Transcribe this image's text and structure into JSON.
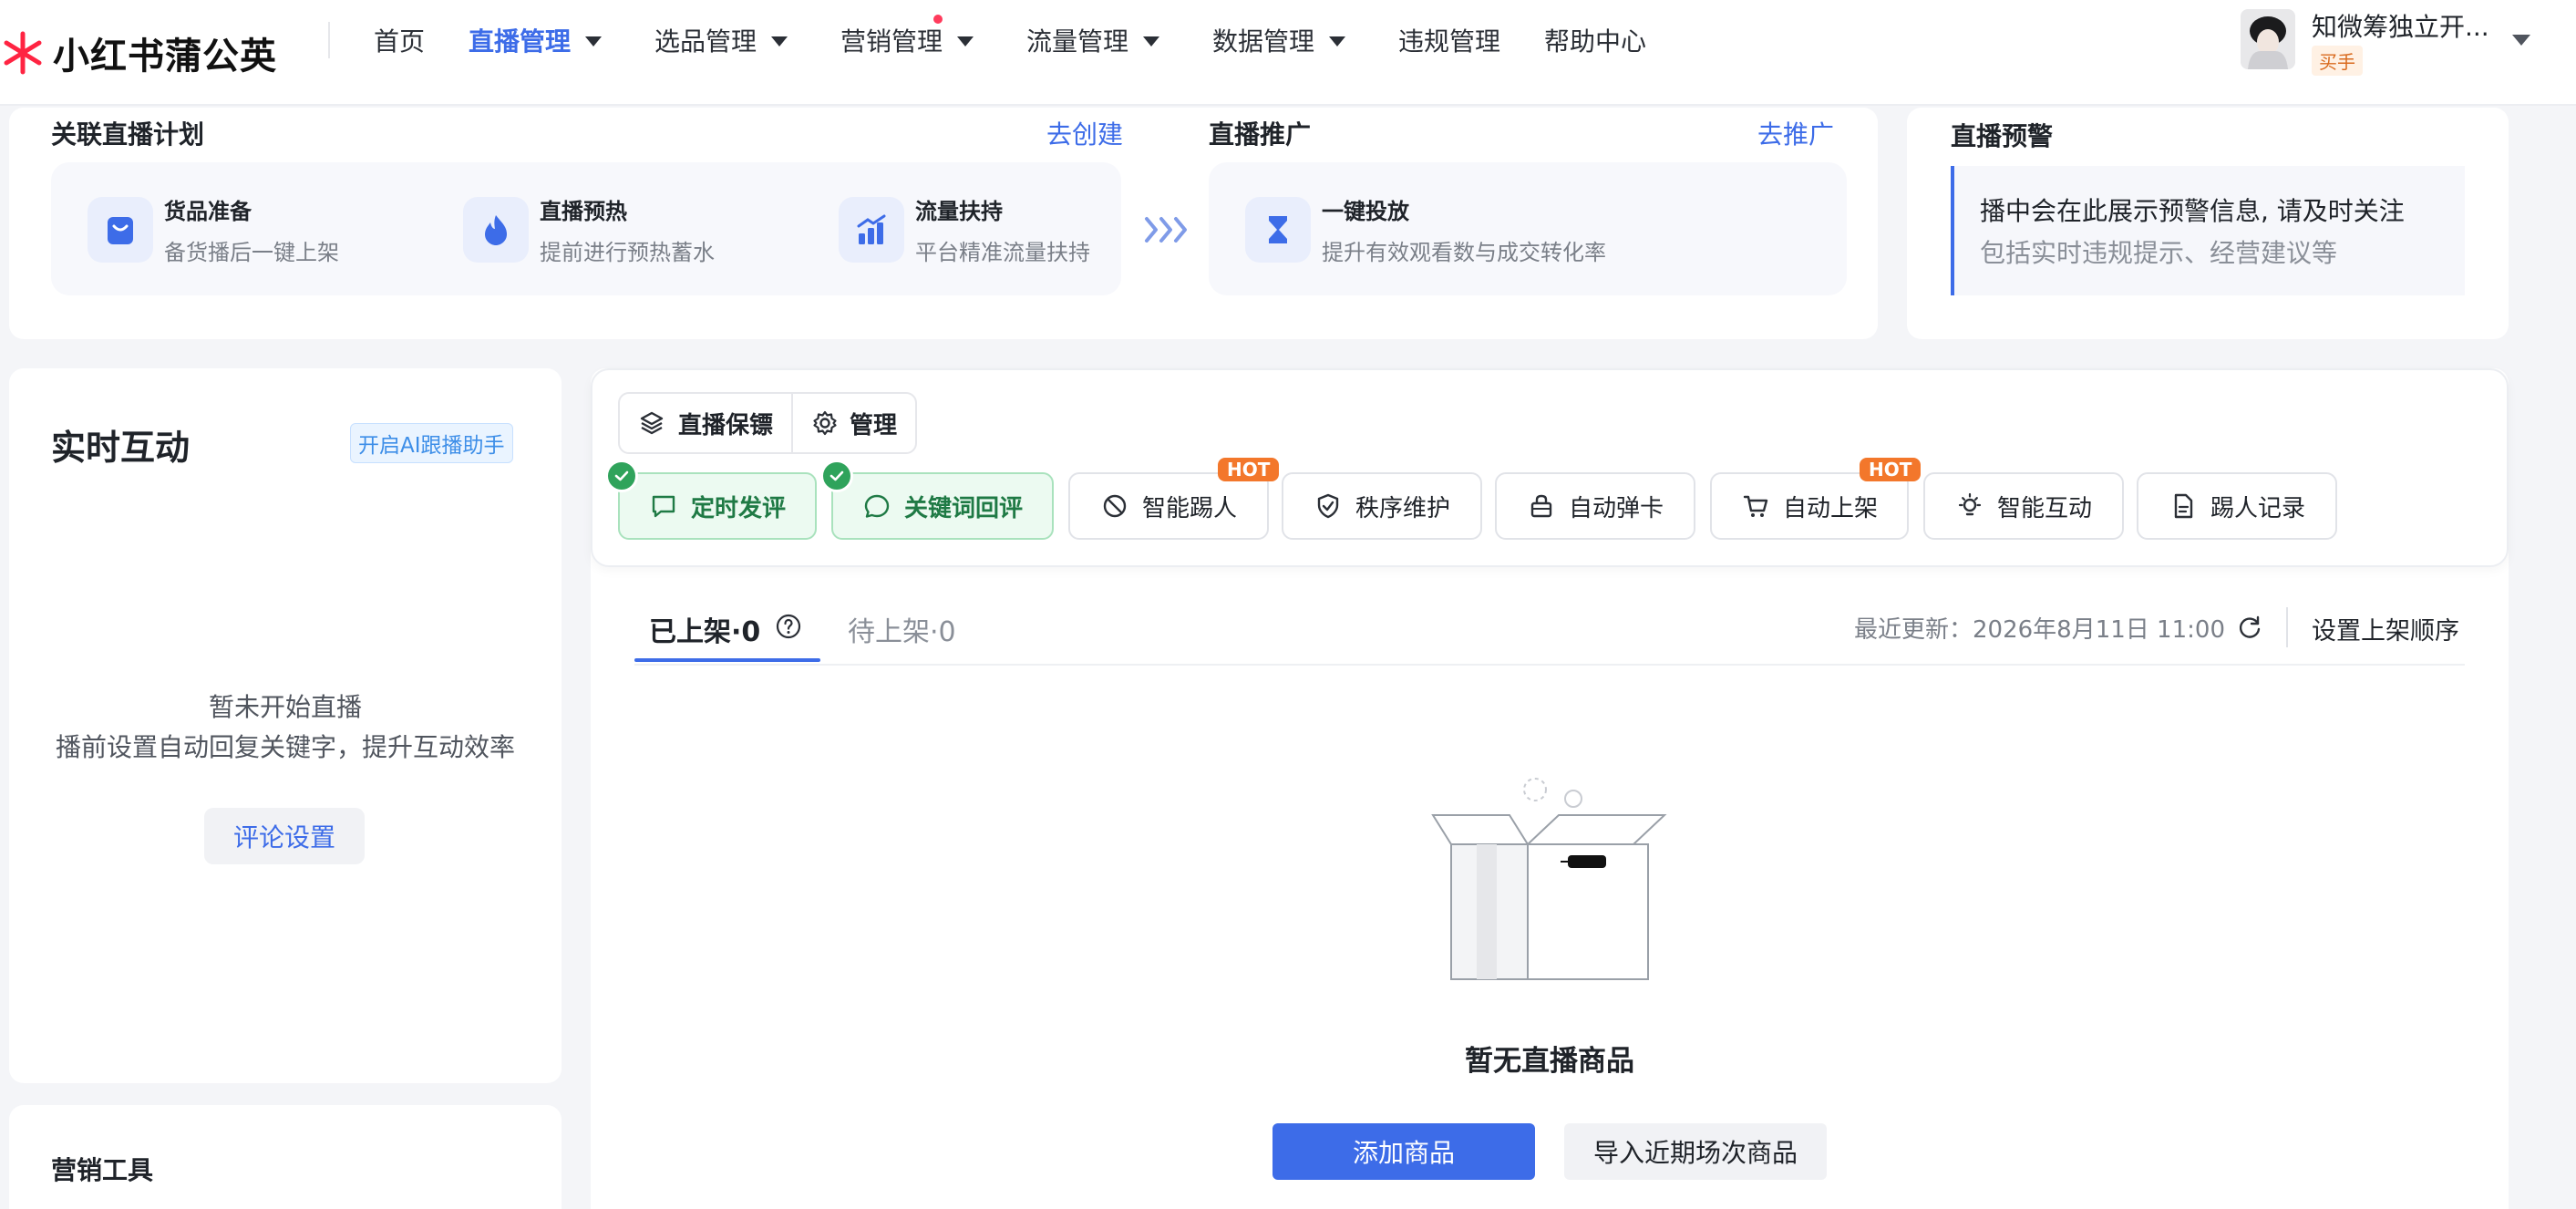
{
  "brand": {
    "logo_text": "小红书蒲公英",
    "logo_color": "#ff2442"
  },
  "nav": {
    "items": [
      {
        "label": "首页"
      },
      {
        "label": "直播管理"
      },
      {
        "label": "选品管理"
      },
      {
        "label": "营销管理"
      },
      {
        "label": "流量管理"
      },
      {
        "label": "数据管理"
      },
      {
        "label": "违规管理"
      },
      {
        "label": "帮助中心"
      }
    ],
    "active": "直播管理"
  },
  "user": {
    "name": "知微筹独立开...",
    "badge": "买手"
  },
  "plan": {
    "title": "关联直播计划",
    "create_link": "去创建",
    "features": [
      {
        "title": "货品准备",
        "desc": "备货播后一键上架",
        "icon": "bag-icon"
      },
      {
        "title": "直播预热",
        "desc": "提前进行预热蓄水",
        "icon": "flame-icon"
      },
      {
        "title": "流量扶持",
        "desc": "平台精准流量扶持",
        "icon": "chart-up-icon"
      }
    ]
  },
  "promo": {
    "title": "直播推广",
    "link": "去推广",
    "feature": {
      "title": "一键投放",
      "desc": "提升有效观看数与成交转化率",
      "icon": "hourglass-icon"
    }
  },
  "warning": {
    "title": "直播预警",
    "line1": "播中会在此展示预警信息, 请及时关注",
    "line2": "包括实时违规提示、经营建议等"
  },
  "interact": {
    "title": "实时互动",
    "ai_tag": "开启AI跟播助手",
    "empty_line1": "暂未开始直播",
    "empty_line2": "播前设置自动回复关键字，提升互动效率",
    "button": "评论设置"
  },
  "marketing": {
    "title": "营销工具"
  },
  "toolbar": {
    "guard": "直播保镖",
    "manage": "管理",
    "tools": [
      {
        "label": "定时发评",
        "icon": "comment-square-icon",
        "enabled": true
      },
      {
        "label": "关键词回评",
        "icon": "comment-round-icon",
        "enabled": true
      },
      {
        "label": "智能踢人",
        "icon": "ban-icon",
        "hot": "HOT"
      },
      {
        "label": "秩序维护",
        "icon": "shield-check-icon"
      },
      {
        "label": "自动弹卡",
        "icon": "lock-card-icon"
      },
      {
        "label": "自动上架",
        "icon": "cart-icon",
        "hot": "HOT"
      },
      {
        "label": "智能互动",
        "icon": "bulb-icon"
      },
      {
        "label": "踢人记录",
        "icon": "document-icon"
      }
    ]
  },
  "tabs": {
    "listed": "已上架·0",
    "pending": "待上架·0"
  },
  "update": {
    "label": "最近更新：2026年8月11日 11:00"
  },
  "order_button": "设置上架顺序",
  "empty": {
    "title": "暂无直播商品",
    "add_button": "添加商品",
    "import_button": "导入近期场次商品"
  },
  "colors": {
    "accent": "#3d6ce8",
    "green": "#2fa35b",
    "hot": "#f3772b"
  }
}
